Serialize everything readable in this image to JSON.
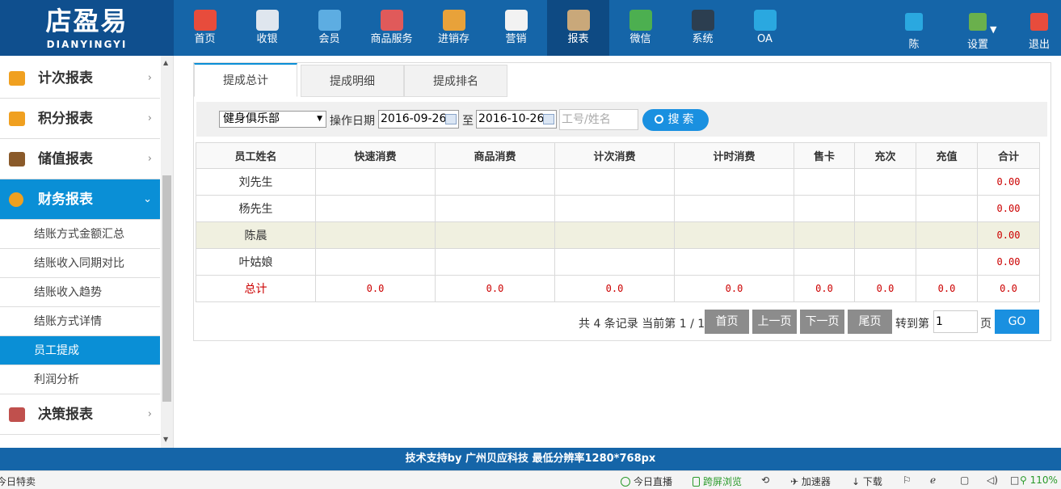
{
  "logo": {
    "big": "店盈易",
    "small": "DIANYINGYI"
  },
  "nav": [
    {
      "label": "首页",
      "icon": "home-icon",
      "color": "#e74c3c"
    },
    {
      "label": "收银",
      "icon": "cash-register-icon",
      "color": "#dfe6ee"
    },
    {
      "label": "会员",
      "icon": "member-icon",
      "color": "#5dade2"
    },
    {
      "label": "商品服务",
      "icon": "goods-icon",
      "color": "#e05a5a"
    },
    {
      "label": "进销存",
      "icon": "inventory-icon",
      "color": "#e8a23a"
    },
    {
      "label": "营销",
      "icon": "megaphone-icon",
      "color": "#f2f2f2"
    },
    {
      "label": "报表",
      "icon": "report-icon",
      "color": "#c9a87a"
    },
    {
      "label": "微信",
      "icon": "wechat-icon",
      "color": "#4caf50"
    },
    {
      "label": "系统",
      "icon": "monitor-icon",
      "color": "#2c3e50"
    },
    {
      "label": "OA",
      "icon": "oa-icon",
      "color": "#2aa8e0"
    }
  ],
  "right_nav": [
    {
      "label": "陈",
      "icon": "user-icon",
      "color": "#2aa8e0"
    },
    {
      "label": "设置",
      "icon": "settings-icon",
      "color": "#6ab04c"
    },
    {
      "label": "退出",
      "icon": "logout-icon",
      "color": "#e74c3c"
    }
  ],
  "sidebar": {
    "groups_top": [
      {
        "label": "计次报表",
        "icon": "bar-chart-icon"
      },
      {
        "label": "积分报表",
        "icon": "tag-icon"
      },
      {
        "label": "储值报表",
        "icon": "wallet-icon"
      }
    ],
    "active_group": {
      "label": "财务报表",
      "icon": "coin-icon"
    },
    "sub_items": [
      "结账方式金额汇总",
      "结账收入同期对比",
      "结账收入趋势",
      "结账方式详情",
      "员工提成",
      "利润分析"
    ],
    "groups_bottom": [
      {
        "label": "决策报表",
        "icon": "thumbs-up-icon"
      }
    ]
  },
  "tabs": [
    "提成总计",
    "提成明细",
    "提成排名"
  ],
  "filter": {
    "store": "健身俱乐部",
    "date_label": "操作日期",
    "date_from": "2016-09-26",
    "to_label": "至",
    "date_to": "2016-10-26",
    "keyword_placeholder": "工号/姓名",
    "search_label": "搜索"
  },
  "table": {
    "headers": [
      "员工姓名",
      "快速消费",
      "商品消费",
      "计次消费",
      "计时消费",
      "售卡",
      "充次",
      "充值",
      "合计"
    ],
    "rows": [
      [
        "刘先生",
        "",
        "",
        "",
        "",
        "",
        "",
        "",
        "0.00"
      ],
      [
        "杨先生",
        "",
        "",
        "",
        "",
        "",
        "",
        "",
        "0.00"
      ],
      [
        "陈晨",
        "",
        "",
        "",
        "",
        "",
        "",
        "",
        "0.00"
      ],
      [
        "叶姑娘",
        "",
        "",
        "",
        "",
        "",
        "",
        "",
        "0.00"
      ]
    ],
    "total_row": [
      "总计",
      "0.0",
      "0.0",
      "0.0",
      "0.0",
      "0.0",
      "0.0",
      "0.0",
      "0.0"
    ]
  },
  "pager": {
    "info": "共 4 条记录 当前第 1 / 1",
    "first": "首页",
    "prev": "上一页",
    "next": "下一页",
    "last": "尾页",
    "goto_label": "转到第",
    "page_value": "1",
    "page_suffix": "页",
    "go": "GO"
  },
  "footer": "技术支持by 广州贝应科技    最低分辨率1280*768px",
  "statusbar": {
    "left": "今日特卖",
    "items": [
      "今日直播",
      "跨屏浏览",
      "加速器",
      "下载"
    ],
    "zoom": "110%"
  }
}
